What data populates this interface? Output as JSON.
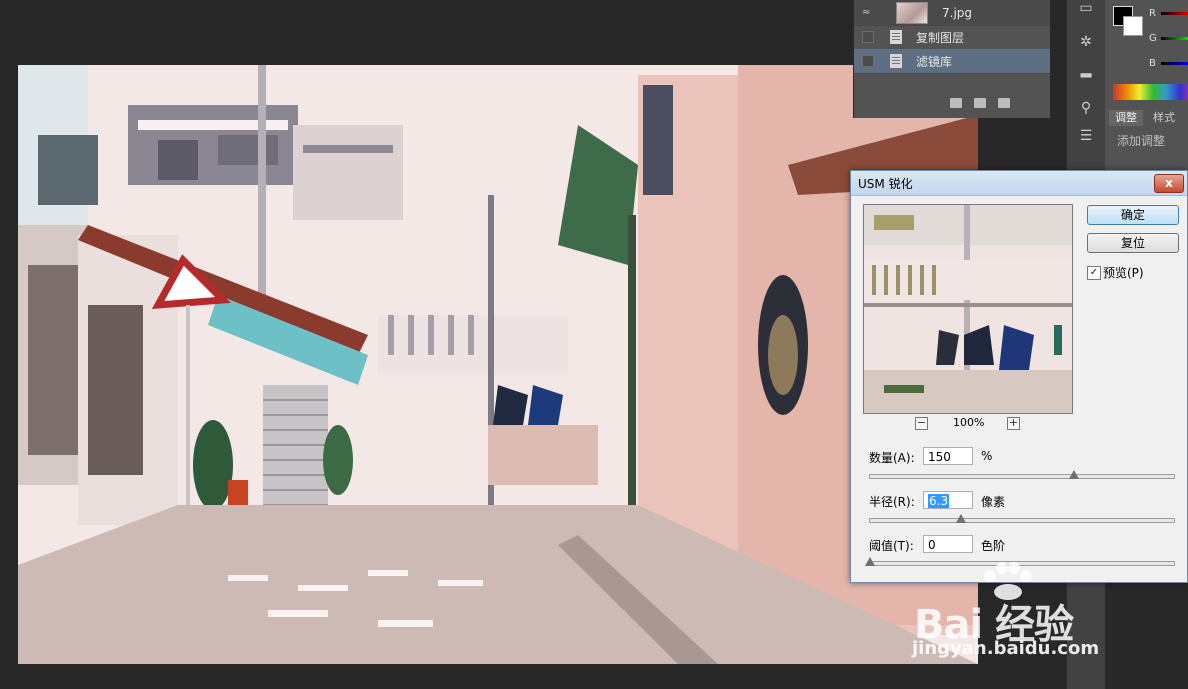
{
  "layers": {
    "top_layer_name": "7.jpg",
    "items": [
      {
        "label": "复制图层"
      },
      {
        "label": "滤镜库"
      }
    ]
  },
  "color_panel": {
    "channels": [
      "R",
      "G",
      "B"
    ],
    "foreground": "#000000",
    "background": "#ffffff"
  },
  "adjustments": {
    "tabs": [
      "调整",
      "样式"
    ],
    "add_label": "添加调整"
  },
  "dialog": {
    "title": "USM 锐化",
    "close_glyph": "x",
    "ok_label": "确定",
    "reset_label": "复位",
    "preview_label": "预览(P)",
    "preview_checked": true,
    "zoom": "100%",
    "zoom_out": "−",
    "zoom_in": "+",
    "amount": {
      "label": "数量(A):",
      "value": "150",
      "unit": "%",
      "slider_fraction": 0.67
    },
    "radius": {
      "label": "半径(R):",
      "value": "6.3",
      "unit": "像素",
      "slider_fraction": 0.3
    },
    "threshold": {
      "label": "阈值(T):",
      "value": "0",
      "unit": "色阶",
      "slider_fraction": 0.0
    }
  },
  "watermark": {
    "brand": "Bai",
    "brand_cn": "经验",
    "url": "jingyan.baidu.com"
  }
}
